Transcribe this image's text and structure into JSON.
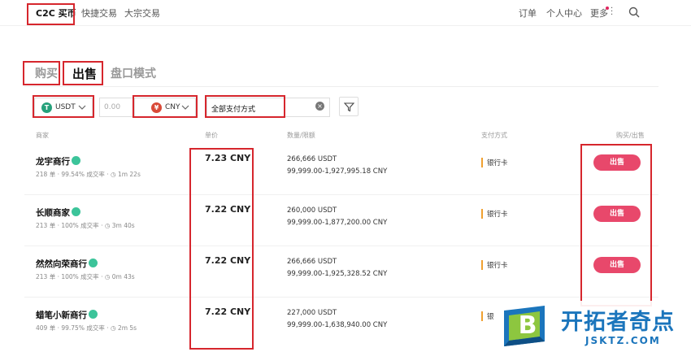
{
  "nav": {
    "items": [
      "C2C 买币",
      "快捷交易",
      "大宗交易"
    ],
    "right": [
      "订单",
      "个人中心",
      "更多"
    ]
  },
  "subtabs": [
    "购买",
    "出售",
    "盘口模式"
  ],
  "filters": {
    "coin": "USDT",
    "coin_glyph": "T",
    "amount_placeholder": "0.00",
    "currency": "CNY",
    "currency_glyph": "¥",
    "payment": "全部支付方式",
    "clear_glyph": "×"
  },
  "columns": [
    "商家",
    "单价",
    "数量/限额",
    "支付方式",
    "购买/出售"
  ],
  "rows": [
    {
      "merchant": "龙宇商行",
      "orders": "218 单",
      "rate": "99.54% 成交率",
      "time": "1m 22s",
      "price": "7.23 CNY",
      "qty": "266,666 USDT",
      "limit": "99,999.00-1,927,995.18 CNY",
      "pay": "银行卡",
      "action": "出售"
    },
    {
      "merchant": "长顺商家",
      "orders": "213 单",
      "rate": "100% 成交率",
      "time": "3m 40s",
      "price": "7.22 CNY",
      "qty": "260,000 USDT",
      "limit": "99,999.00-1,877,200.00 CNY",
      "pay": "银行卡",
      "action": "出售"
    },
    {
      "merchant": "然然向荣商行",
      "orders": "213 单",
      "rate": "100% 成交率",
      "time": "0m 43s",
      "price": "7.22 CNY",
      "qty": "266,666 USDT",
      "limit": "99,999.00-1,925,328.52 CNY",
      "pay": "银行卡",
      "action": "出售"
    },
    {
      "merchant": "蜡笔小新商行",
      "orders": "409 单",
      "rate": "99.75% 成交率",
      "time": "2m 5s",
      "price": "7.22 CNY",
      "qty": "227,000 USDT",
      "limit": "99,999.00-1,638,940.00 CNY",
      "pay": "银",
      "action": ""
    }
  ],
  "watermark": {
    "logo_letter": "B",
    "title": "开拓者奇点",
    "subtitle": "JSKTZ.COM"
  },
  "colors": {
    "accent": "#e8486b",
    "highlight": "#d6262d",
    "usdt": "#26a17b",
    "cny": "#d94a38",
    "badge": "#3cc49a"
  }
}
